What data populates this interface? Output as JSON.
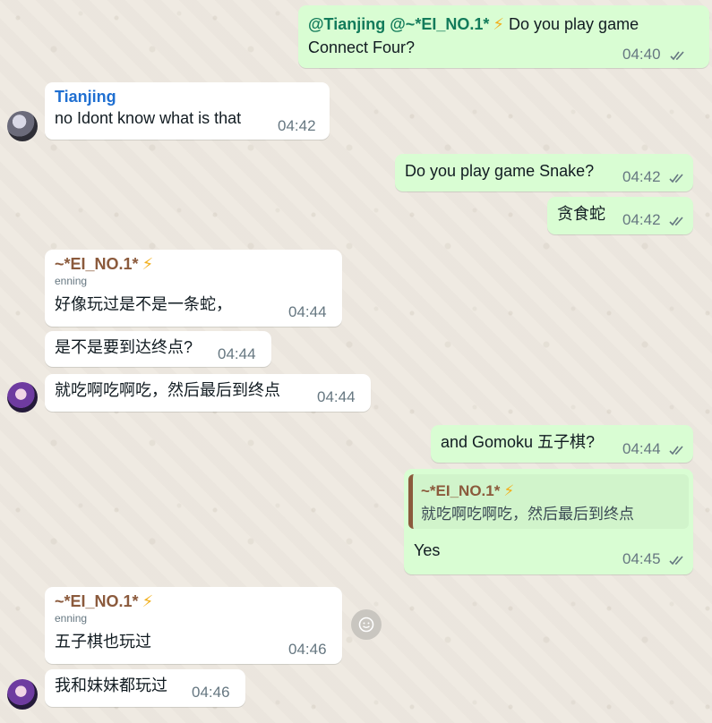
{
  "messages": {
    "m1": {
      "mention1": "@Tianjing",
      "mention2": "@~*EI_NO.1*",
      "bolt": "⚡",
      "text_line1": " Do you play game",
      "text_line2": "Connect Four?",
      "time": "04:40"
    },
    "m2": {
      "sender": "Tianjing",
      "text": "no Idont know what is that",
      "time": "04:42"
    },
    "m3": {
      "text": "Do you play game Snake?",
      "time": "04:42"
    },
    "m4": {
      "text": "贪食蛇",
      "time": "04:42"
    },
    "m5": {
      "sender": "~*EI_NO.1*",
      "bolt": "⚡",
      "sub": "enning",
      "text": "好像玩过是不是一条蛇，",
      "time": "04:44"
    },
    "m6": {
      "text": "是不是要到达终点?",
      "time": "04:44"
    },
    "m7": {
      "text": "就吃啊吃啊吃，然后最后到终点",
      "time": "04:44"
    },
    "m8": {
      "text": "and Gomoku 五子棋?",
      "time": "04:44"
    },
    "m9": {
      "quote_sender": "~*EI_NO.1*",
      "quote_bolt": "⚡",
      "quote_text": "就吃啊吃啊吃，然后最后到终点",
      "text": "Yes",
      "time": "04:45"
    },
    "m10": {
      "sender": "~*EI_NO.1*",
      "bolt": "⚡",
      "sub": "enning",
      "text": "五子棋也玩过",
      "time": "04:46"
    },
    "m11": {
      "text": "我和妹妹都玩过",
      "time": "04:46"
    }
  },
  "icons": {
    "read_ticks": "double-check-icon",
    "reaction": "emoji-icon"
  },
  "colors": {
    "background": "#efeae2",
    "incoming": "#ffffff",
    "outgoing": "#d9fdd3",
    "mention": "#137b5b",
    "sender_blue": "#1f6fd1",
    "sender_brown": "#8b5a3c",
    "bolt": "#f2b01e"
  }
}
